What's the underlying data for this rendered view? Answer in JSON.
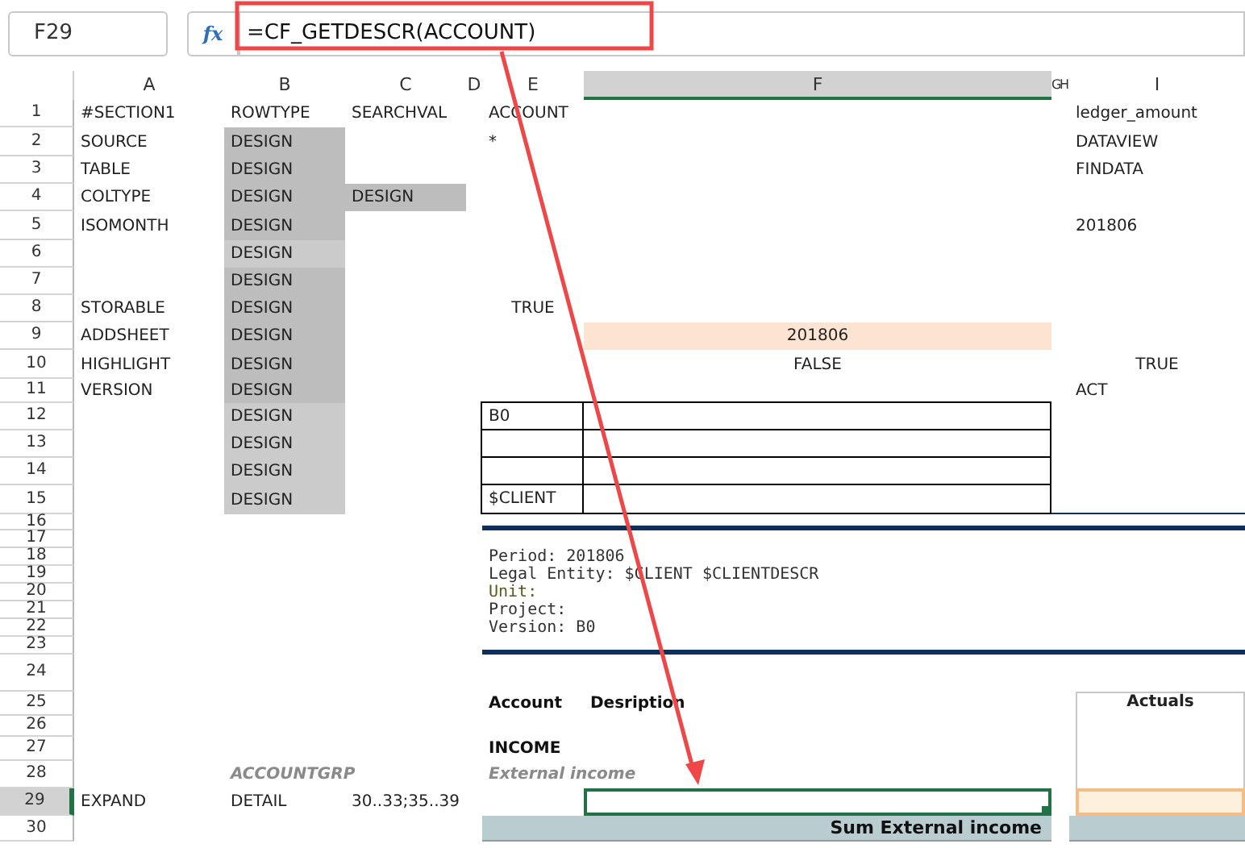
{
  "name_box": "F29",
  "fx": "fx",
  "formula": "=CF_GETDESCR(ACCOUNT)",
  "columns": [
    {
      "label": "A",
      "selected": false
    },
    {
      "label": "B",
      "selected": false
    },
    {
      "label": "C",
      "selected": false
    },
    {
      "label": "D",
      "selected": false
    },
    {
      "label": "E",
      "selected": false
    },
    {
      "label": "F",
      "selected": true
    },
    {
      "label": "G",
      "selected": false
    },
    {
      "label": "H",
      "selected": false
    },
    {
      "label": "I",
      "selected": false
    }
  ],
  "rows": [
    {
      "header": "1",
      "selected": false,
      "cells": {
        "A": {
          "text": "#SECTION1"
        },
        "B": {
          "text": "ROWTYPE"
        },
        "C": {
          "text": "SEARCHVAL"
        },
        "E:F": {
          "text": "ACCOUNT"
        },
        "I": {
          "text": "ledger_amount"
        }
      }
    },
    {
      "header": "2",
      "selected": false,
      "cells": {
        "A": {
          "text": "SOURCE"
        },
        "B": {
          "text": "DESIGN",
          "kind": "design"
        },
        "E": {
          "text": "*"
        },
        "I": {
          "text": "DATAVIEW"
        }
      }
    },
    {
      "header": "3",
      "selected": false,
      "cells": {
        "A": {
          "text": "TABLE"
        },
        "B": {
          "text": "DESIGN",
          "kind": "design"
        },
        "I": {
          "text": "FINDATA"
        }
      }
    },
    {
      "header": "4",
      "selected": false,
      "cells": {
        "A": {
          "text": "COLTYPE"
        },
        "B": {
          "text": "DESIGN",
          "kind": "design"
        },
        "C": {
          "text": "DESIGN",
          "kind": "design"
        }
      }
    },
    {
      "header": "5",
      "selected": false,
      "cells": {
        "A": {
          "text": "ISOMONTH"
        },
        "B": {
          "text": "DESIGN",
          "kind": "design"
        },
        "I": {
          "text": "201806"
        }
      }
    },
    {
      "header": "6",
      "selected": false,
      "cells": {
        "B": {
          "text": "DESIGN",
          "kind": "design-light"
        }
      }
    },
    {
      "header": "7",
      "selected": false,
      "cells": {
        "B": {
          "text": "DESIGN",
          "kind": "design"
        }
      }
    },
    {
      "header": "8",
      "selected": false,
      "cells": {
        "A": {
          "text": "STORABLE"
        },
        "B": {
          "text": "DESIGN",
          "kind": "design"
        },
        "E": {
          "text": "TRUE",
          "kind": "center"
        }
      }
    },
    {
      "header": "9",
      "selected": false,
      "cells": {
        "A": {
          "text": "ADDSHEET"
        },
        "B": {
          "text": "DESIGN",
          "kind": "design"
        },
        "F": {
          "text": "201806",
          "kind": "highlight"
        }
      }
    },
    {
      "header": "10",
      "selected": false,
      "cells": {
        "A": {
          "text": "HIGHLIGHT"
        },
        "B": {
          "text": "DESIGN",
          "kind": "design"
        },
        "F": {
          "text": "FALSE",
          "kind": "center"
        },
        "I": {
          "text": "TRUE",
          "kind": "center"
        }
      }
    },
    {
      "header": "11",
      "selected": false,
      "cells": {
        "A": {
          "text": "VERSION"
        },
        "B": {
          "text": "DESIGN",
          "kind": "design"
        },
        "I": {
          "text": "ACT"
        }
      }
    },
    {
      "header": "12",
      "selected": false,
      "cells": {
        "B": {
          "text": "DESIGN",
          "kind": "design-light"
        },
        "E": {
          "text": "B0",
          "kind": "bordered"
        },
        "F": {
          "kind": "bordered"
        }
      }
    },
    {
      "header": "13",
      "selected": false,
      "cells": {
        "B": {
          "text": "DESIGN",
          "kind": "design-light"
        },
        "E": {
          "kind": "bordered"
        },
        "F": {
          "kind": "bordered"
        }
      }
    },
    {
      "header": "14",
      "selected": false,
      "cells": {
        "B": {
          "text": "DESIGN",
          "kind": "design-light"
        },
        "E": {
          "kind": "bordered"
        },
        "F": {
          "kind": "bordered"
        }
      }
    },
    {
      "header": "15",
      "selected": false,
      "cells": {
        "B": {
          "text": "DESIGN",
          "kind": "design-light"
        },
        "E": {
          "text": "$CLIENT",
          "kind": "bordered"
        },
        "F": {
          "kind": "bordered"
        },
        "G:I": {
          "kind": "rule-thin"
        }
      }
    },
    {
      "header": "16",
      "selected": false,
      "cells": {
        "E:I": {
          "kind": "rule-thick"
        }
      }
    },
    {
      "header": "17",
      "selected": false,
      "cells": {}
    },
    {
      "header": "18",
      "selected": false,
      "cells": {
        "E:I": {
          "text": "Period: 201806",
          "kind": "mono"
        }
      }
    },
    {
      "header": "19",
      "selected": false,
      "cells": {
        "E:I": {
          "text": "Legal Entity: $CLIENT $CLIENTDESCR",
          "kind": "mono"
        }
      }
    },
    {
      "header": "20",
      "selected": false,
      "cells": {
        "E:I": {
          "text": "Unit:",
          "kind": "mono-olive"
        }
      }
    },
    {
      "header": "21",
      "selected": false,
      "cells": {
        "E:I": {
          "text": "Project:",
          "kind": "mono"
        }
      }
    },
    {
      "header": "22",
      "selected": false,
      "cells": {
        "E:I": {
          "text": "Version: B0",
          "kind": "mono"
        }
      }
    },
    {
      "header": "23",
      "selected": false,
      "cells": {
        "E:I": {
          "kind": "rule-thick"
        }
      }
    },
    {
      "header": "24",
      "selected": false,
      "cells": {}
    },
    {
      "header": "25",
      "selected": false,
      "cells": {
        "E": {
          "text": "Account",
          "kind": "heading"
        },
        "F": {
          "text": "Desription",
          "kind": "heading"
        },
        "I": {
          "text": "Actuals",
          "kind": "frame"
        }
      }
    },
    {
      "header": "26",
      "selected": false,
      "cells": {}
    },
    {
      "header": "27",
      "selected": false,
      "cells": {
        "E": {
          "text": "INCOME",
          "kind": "heading"
        }
      }
    },
    {
      "header": "28",
      "selected": false,
      "cells": {
        "B:C": {
          "text": "ACCOUNTGRP",
          "kind": "group"
        },
        "E:F": {
          "text": "External income",
          "kind": "group"
        }
      }
    },
    {
      "header": "29",
      "selected": true,
      "cells": {
        "A": {
          "text": "EXPAND"
        },
        "B": {
          "text": "DETAIL"
        },
        "C:D": {
          "text": "30..33;35..39"
        },
        "F": {
          "kind": "selected"
        },
        "I": {
          "kind": "input"
        }
      }
    },
    {
      "header": "30",
      "selected": false,
      "cells": {
        "E:F": {
          "text": "Sum External income",
          "kind": "subtotal"
        },
        "I": {
          "kind": "subtotal"
        }
      }
    }
  ]
}
